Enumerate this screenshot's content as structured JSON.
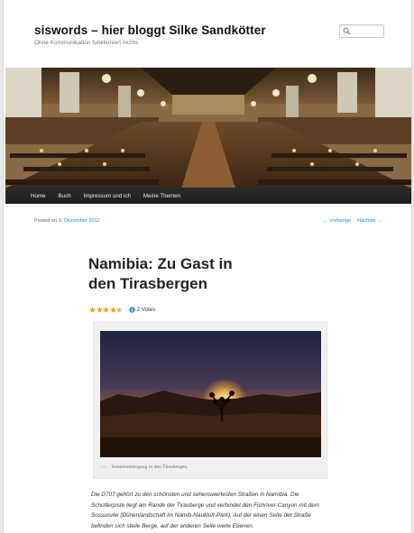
{
  "site": {
    "title": "siswords – hier bloggt Silke Sandkötter",
    "description": "Ohne Kommunikation funktioniert nichts"
  },
  "search": {
    "placeholder": "",
    "icon": "search-icon"
  },
  "nav": {
    "items": [
      {
        "label": "Home"
      },
      {
        "label": "Buch"
      },
      {
        "label": "Impressum und ich"
      },
      {
        "label": "Meine Themen"
      }
    ]
  },
  "post": {
    "posted_on_label": "Posted on",
    "date": "9. Dezember 2012",
    "prev_label": "← Vorherige",
    "next_label": "Nächste →",
    "title": "Namibia: Zu Gast in den Tirasbergen",
    "rating": {
      "stars": 4.5,
      "max": 5,
      "votes_label": "2 Votes"
    },
    "caption": "Sonnenuntergang in den Tirasbergen.",
    "caption_dash": "—",
    "body": "Die D707 gehört zu den schönsten und sehenswertesten Straßen in Namibia. Die Schotterpiste liegt am Rande der Tirasberge und verbindet den Fishriver-Canyon mit dem Sossusvlei (Dünenlandschaft im Namib-Naukluft-Park). Auf der einen Seite der Straße befinden sich steile Berge, auf der anderen Seite weite Ebenen,"
  },
  "colors": {
    "link": "#1b8be0",
    "nav_bg": "#222222",
    "star": "#e8a317"
  }
}
